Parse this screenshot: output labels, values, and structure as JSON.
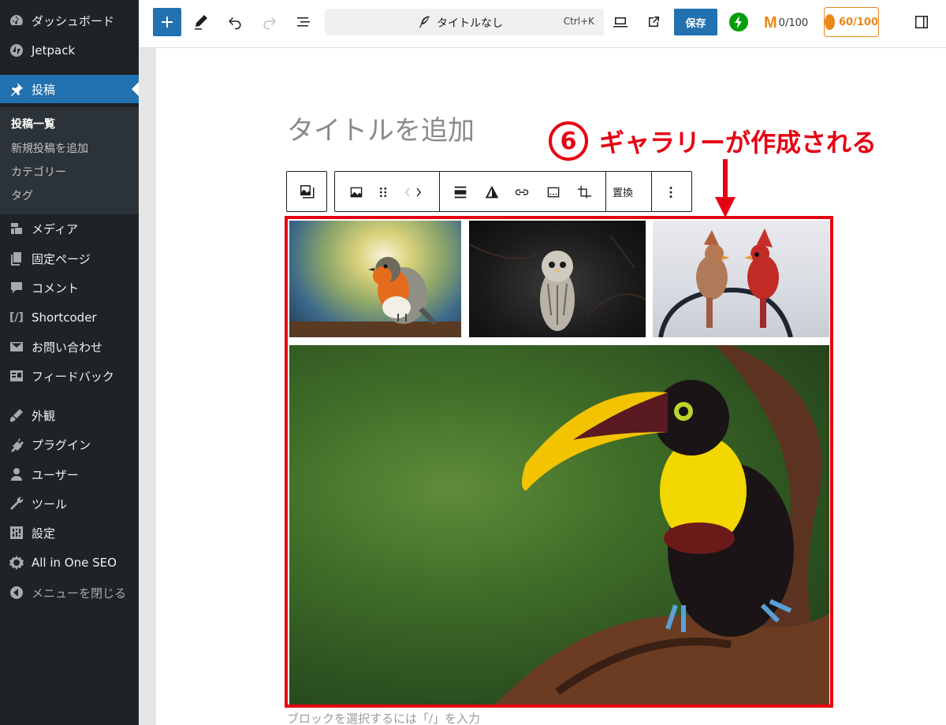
{
  "sidebar": {
    "items": [
      {
        "label": "ダッシュボード",
        "icon": "dashboard-icon"
      },
      {
        "label": "Jetpack",
        "icon": "jetpack-icon"
      },
      {
        "label": "投稿",
        "icon": "pin-icon",
        "active": true
      },
      {
        "label": "メディア",
        "icon": "media-icon"
      },
      {
        "label": "固定ページ",
        "icon": "pages-icon"
      },
      {
        "label": "コメント",
        "icon": "comment-icon"
      },
      {
        "label": "Shortcoder",
        "icon": "shortcode-icon"
      },
      {
        "label": "お問い合わせ",
        "icon": "mail-icon"
      },
      {
        "label": "フィードバック",
        "icon": "feedback-icon"
      },
      {
        "label": "外観",
        "icon": "appearance-icon"
      },
      {
        "label": "プラグイン",
        "icon": "plugin-icon"
      },
      {
        "label": "ユーザー",
        "icon": "user-icon"
      },
      {
        "label": "ツール",
        "icon": "tool-icon"
      },
      {
        "label": "設定",
        "icon": "settings-icon"
      },
      {
        "label": "All in One SEO",
        "icon": "aioseo-icon"
      },
      {
        "label": "メニューを閉じる",
        "icon": "collapse-icon"
      }
    ],
    "submenu": [
      "投稿一覧",
      "新規投稿を追加",
      "カテゴリー",
      "タグ"
    ]
  },
  "toolbar": {
    "document_title": "タイトルなし",
    "shortcut": "Ctrl+K",
    "save_label": "保存",
    "m_score": "0/100",
    "aioseo_score": "60/100"
  },
  "editor": {
    "title_placeholder": "タイトルを追加",
    "block_placeholder": "ブロックを選択するには「/」を入力",
    "replace_label": "置換"
  },
  "annotation": {
    "number": "6",
    "text": "ギャラリーが作成される"
  },
  "colors": {
    "sidebar_bg": "#1d2327",
    "accent": "#2271b1",
    "annotation_red": "#e60012",
    "aioseo_orange": "#e8891a"
  }
}
